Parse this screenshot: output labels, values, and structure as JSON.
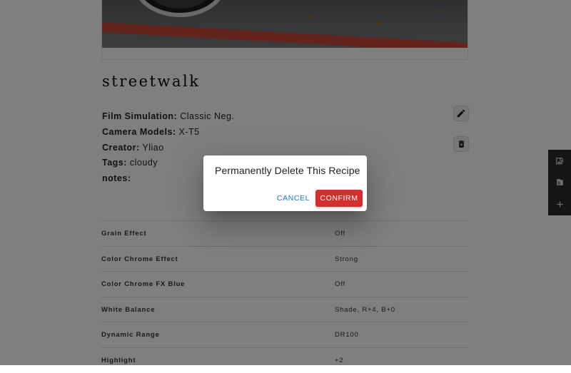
{
  "recipe": {
    "title": "streetwalk",
    "film_simulation_label": "Film Simulation:",
    "film_simulation": "Classic Neg.",
    "camera_models_label": "Camera Models:",
    "camera_models": "X-T5",
    "creator_label": "Creator:",
    "creator": "Yliao",
    "tags_label": "Tags:",
    "tags": "cloudy",
    "notes_label": "notes:"
  },
  "settings": [
    {
      "key": "Grain Effect",
      "value": "Off"
    },
    {
      "key": "Color Chrome Effect",
      "value": "Strong"
    },
    {
      "key": "Color Chrome FX Blue",
      "value": "Off"
    },
    {
      "key": "White Balance",
      "value": "Shade, R+4, B+0"
    },
    {
      "key": "Dynamic Range",
      "value": "DR100"
    },
    {
      "key": "Highlight",
      "value": "+2"
    }
  ],
  "actions": {
    "edit_icon": "pencil-icon",
    "delete_icon": "trash-icon"
  },
  "sidebar": {
    "items": [
      "image-search-icon",
      "folder-icon",
      "plus-icon"
    ]
  },
  "dialog": {
    "title": "Permanently Delete This Recipe",
    "cancel_label": "CANCEL",
    "confirm_label": "CONFIRM"
  },
  "colors": {
    "confirm": "#d32f2f",
    "cancel": "#1976d2",
    "sidebar": "#2b2b2b"
  }
}
